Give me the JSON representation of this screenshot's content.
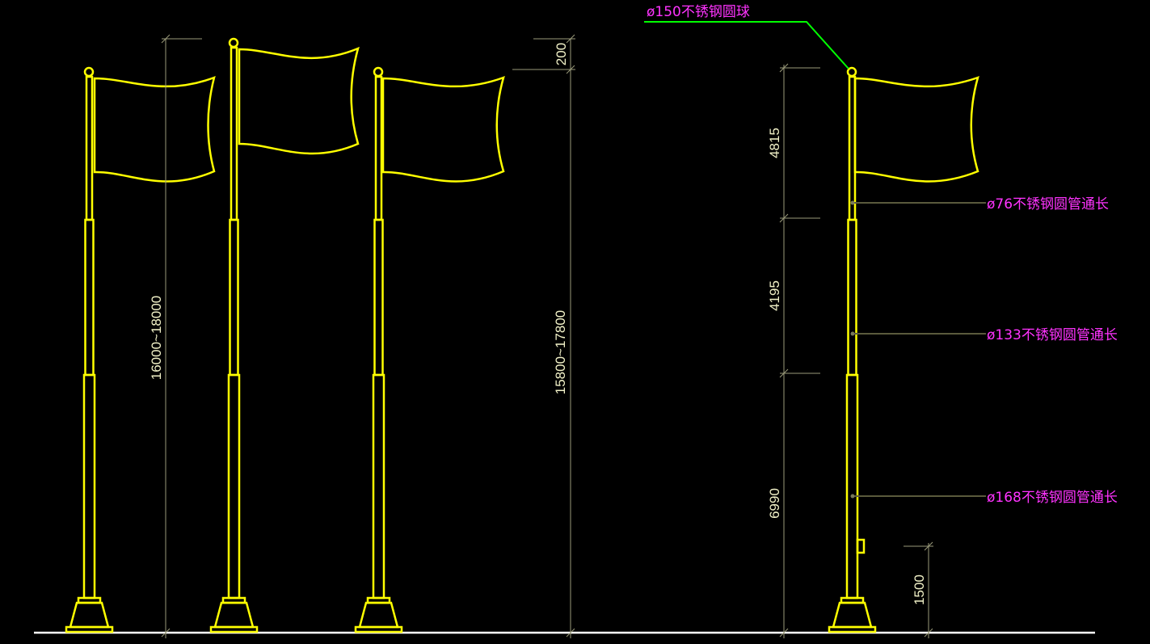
{
  "dimensions": {
    "overall_height_range": "16000~18000",
    "flag_to_top_offset": "200",
    "pole_height_range": "15800~17800",
    "top_section": "4815",
    "middle_section": "4195",
    "bottom_section": "6990",
    "winch_height": "1500"
  },
  "callouts": {
    "ball": "ø150不锈钢圆球",
    "tube_top": "ø76不锈钢圆管通长",
    "tube_middle": "ø133不锈钢圆管通长",
    "tube_bottom": "ø168不锈钢圆管通长"
  },
  "colors": {
    "background": "#000000",
    "pole": "#ffff00",
    "ground": "#ffffff",
    "callout_text": "#ff33ff",
    "ball_leader": "#00ff00",
    "dimension": "#9a9a7a"
  },
  "icons": {
    "pole": "flagpole-icon",
    "flag": "flag-icon",
    "base": "pole-base-icon"
  }
}
